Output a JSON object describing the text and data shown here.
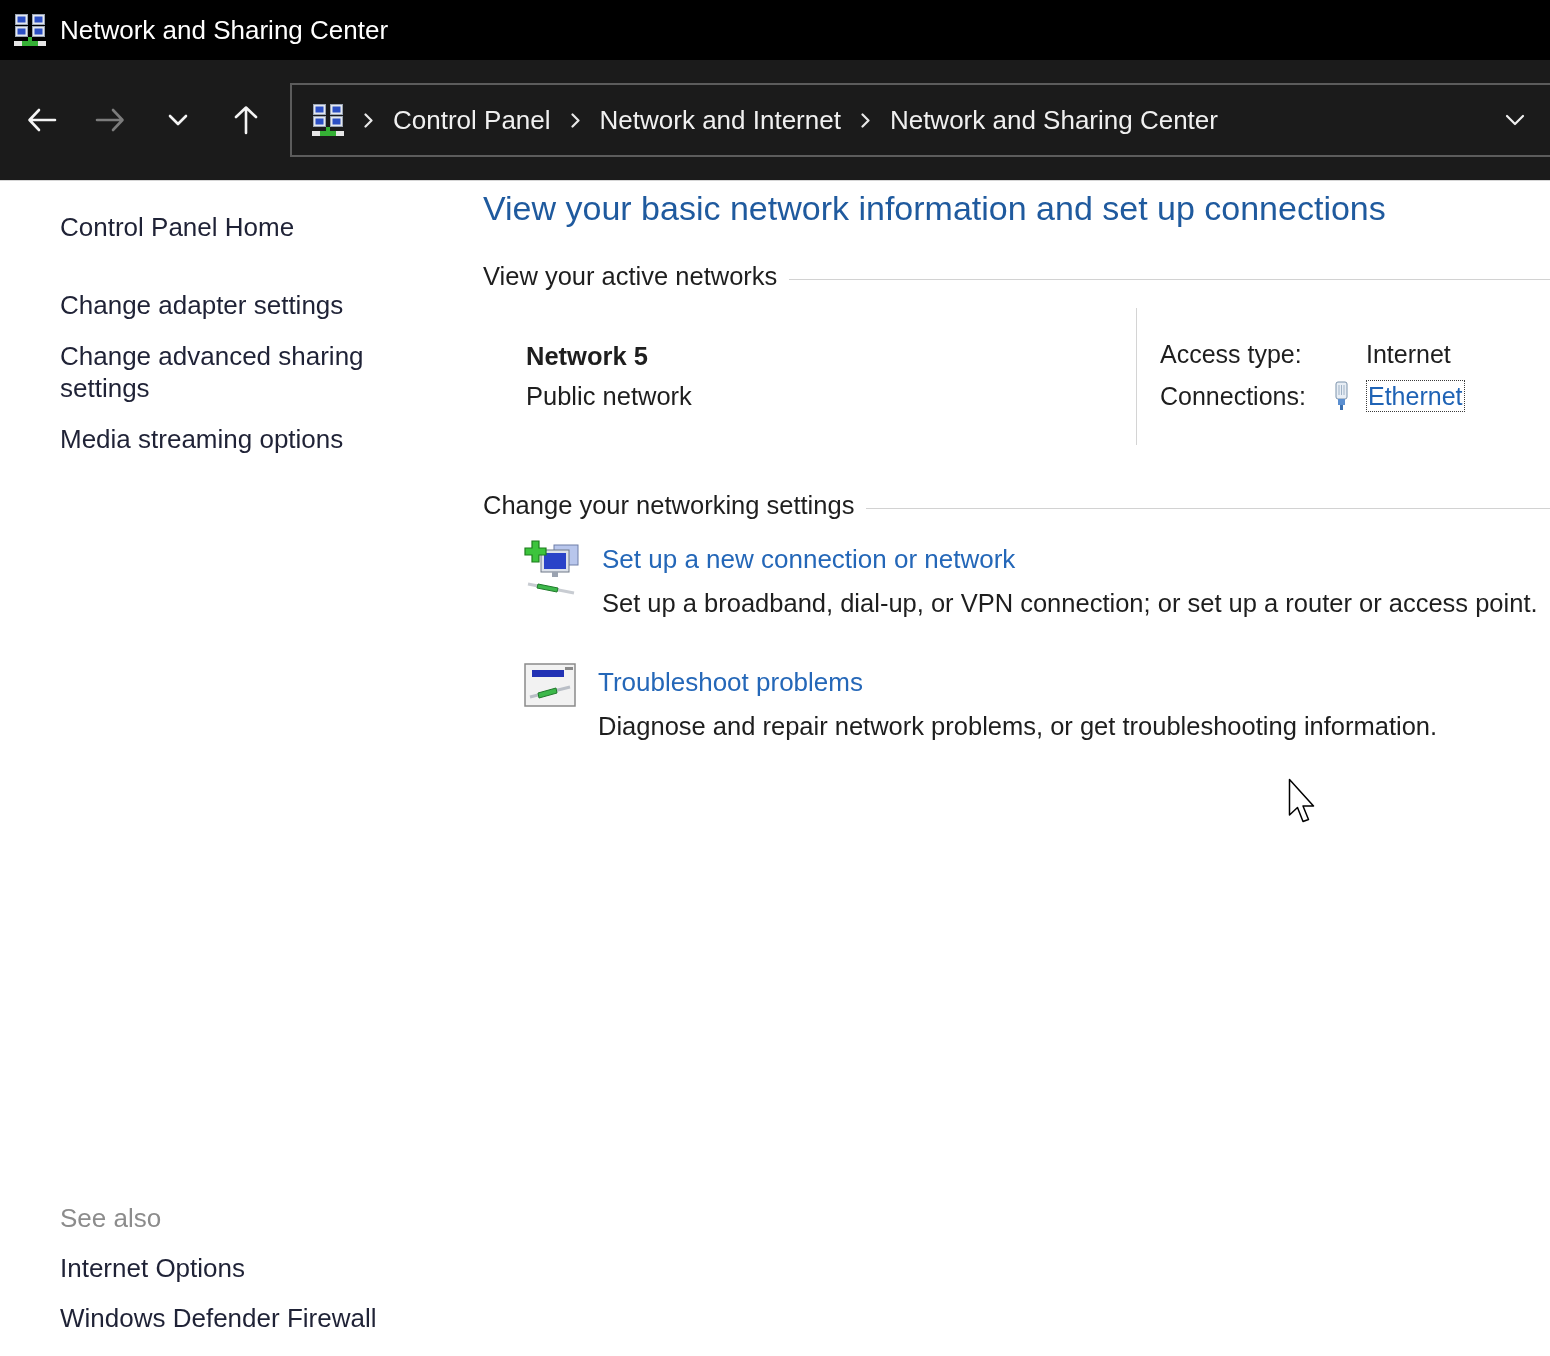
{
  "window": {
    "title": "Network and Sharing Center"
  },
  "navigation": {
    "buttons": [
      {
        "kind": "back",
        "disabled": false
      },
      {
        "kind": "forward",
        "disabled": true
      },
      {
        "kind": "recent",
        "disabled": false
      },
      {
        "kind": "up",
        "disabled": false
      }
    ],
    "address_bar": {
      "breadcrumbs": [
        "Control Panel",
        "Network and Internet",
        "Network and Sharing Center"
      ]
    }
  },
  "sidebar": {
    "home_link": "Control Panel Home",
    "tasks": [
      "Change adapter settings",
      "Change advanced sharing settings",
      "Media streaming options"
    ],
    "see_also": {
      "heading": "See also",
      "links": [
        "Internet Options",
        "Windows Defender Firewall"
      ]
    }
  },
  "main": {
    "heading": "View your basic network information and set up connections",
    "active_networks": {
      "heading": "View your active networks",
      "networks": [
        {
          "name": "Network 5",
          "category": "Public network",
          "access_type_label": "Access type:",
          "access_type": "Internet",
          "connections_label": "Connections:",
          "connection": "Ethernet",
          "connection_focused": true
        }
      ]
    },
    "settings": {
      "heading": "Change your networking settings",
      "tasks": [
        {
          "kind": "new_connection",
          "title": "Set up a new connection or network",
          "description": "Set up a broadband, dial-up, or VPN connection; or set up a router or access point."
        },
        {
          "kind": "troubleshoot",
          "title": "Troubleshoot problems",
          "description": "Diagnose and repair network problems, or get troubleshooting information."
        }
      ]
    }
  }
}
